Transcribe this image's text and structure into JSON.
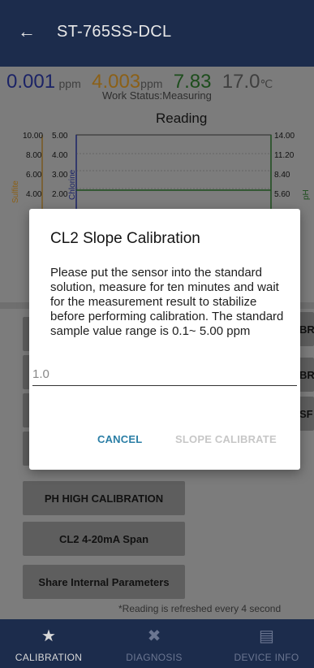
{
  "appbar": {
    "back_icon": "arrow-left-icon",
    "title": "ST-765SS-DCL"
  },
  "readings": {
    "chlorine_value": "0.001",
    "chlorine_unit": "ppm",
    "sulfite_value": "4.003",
    "sulfite_unit": "ppm",
    "ph_value": "7.83",
    "temp_value": "17.0",
    "temp_unit": "℃",
    "work_status": "Work Status:Measuring"
  },
  "chart_data": {
    "type": "line",
    "title": "Reading",
    "axes": [
      {
        "name": "Sulfite",
        "color": "#8b6017",
        "ticks": [
          "10.00",
          "8.00",
          "6.00",
          "4.00"
        ]
      },
      {
        "name": "Chlorine",
        "color": "#1b2366",
        "ticks": [
          "5.00",
          "4.00",
          "3.00",
          "2.00"
        ]
      },
      {
        "name": "pH",
        "color": "#1d4d1c",
        "ticks": [
          "14.00",
          "11.20",
          "8.40",
          "5.60"
        ]
      }
    ],
    "series": [
      {
        "name": "pH",
        "color": "#1d4d1c",
        "values": [
          7.83
        ]
      }
    ]
  },
  "buttons": {
    "left": [
      {
        "label": ""
      },
      {
        "label": ""
      },
      {
        "label": ""
      },
      {
        "label": ""
      },
      {
        "label": "PH HIGH CALIBRATION"
      },
      {
        "label": "CL2 4-20mA Span"
      },
      {
        "label": "Share Internal Parameters"
      }
    ],
    "right_partial": [
      "BR",
      "BR",
      "SF"
    ]
  },
  "footnote": "*Reading is refreshed every 4 second",
  "nav": {
    "items": [
      {
        "label": "CALIBRATION",
        "icon": "star-icon"
      },
      {
        "label": "DIAGNOSIS",
        "icon": "tools-icon"
      },
      {
        "label": "DEVICE INFO",
        "icon": "document-icon"
      }
    ]
  },
  "dialog": {
    "title": "CL2 Slope Calibration",
    "message": "Please put the sensor into the standard solution, measure for ten minutes and wait for the measurement result to stabilize before performing calibration. The standard sample value range is 0.1~ 5.00 ppm",
    "input_placeholder": "1.0",
    "cancel_label": "CANCEL",
    "confirm_label": "SLOPE CALIBRATE"
  },
  "colors": {
    "appbar": "#1c2c4c",
    "accent": "#2a7ea5",
    "disabled": "#c7c7c7"
  }
}
